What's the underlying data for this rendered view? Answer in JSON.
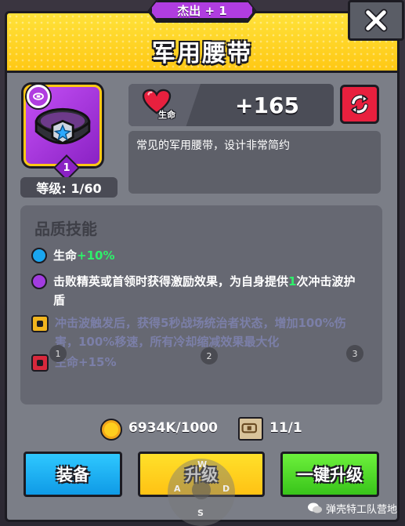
{
  "header": {
    "rarity": "杰出 + 1",
    "title": "军用腰带"
  },
  "item": {
    "level_badge": "1",
    "level_label": "等级: 1/60"
  },
  "stat": {
    "name": "生命",
    "value": "+165"
  },
  "description": "常见的军用腰带，设计非常简约",
  "skills": {
    "title": "品质技能",
    "rows": [
      {
        "prefix": "生命",
        "highlight": "+10%",
        "suffix": "",
        "state": "active",
        "dot": "blue"
      },
      {
        "prefix": "击败精英或首领时获得激励效果，为自身提供",
        "highlight": "1",
        "suffix": "次冲击波护盾",
        "state": "active",
        "dot": "purple"
      },
      {
        "text": "冲击波触发后，获得5秒战场统治者状态，增加100%伤害，100%移速，所有冷却缩减效果最大化",
        "state": "locked",
        "lock": "gold"
      },
      {
        "text": "生命+15%",
        "state": "locked",
        "lock": "red"
      }
    ],
    "page_markers": [
      "1",
      "2",
      "3"
    ]
  },
  "resources": {
    "coins": "6934K/1000",
    "scrolls": "11/1"
  },
  "buttons": {
    "equip": "装备",
    "upgrade": "升级",
    "upgrade_all": "一键升级"
  },
  "joystick": {
    "w": "W",
    "a": "A",
    "s": "S",
    "d": "D"
  },
  "watermark": "弹壳特工队营地",
  "colors": {
    "header": "#ffc814",
    "rarity": "#b03de0",
    "panel": "#7b7e87",
    "highlight_green": "#2ef06a",
    "equip_btn": "#1aaef0",
    "upgrade_btn": "#ffc814",
    "upgrade_all_btn": "#39c41a",
    "reroll_btn": "#e8203e"
  }
}
